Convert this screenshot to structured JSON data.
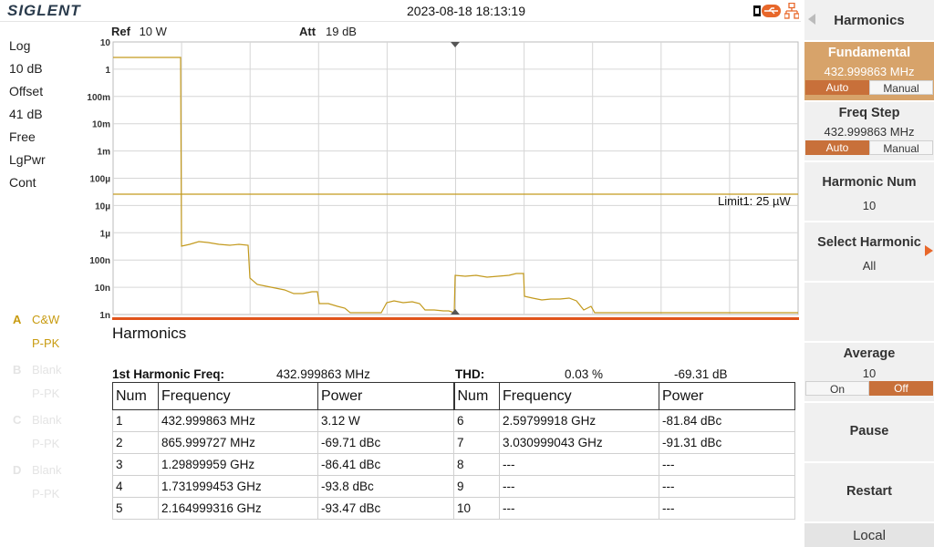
{
  "top_bar": {
    "brand": "SIGLENT",
    "datetime": "2023-08-18 18:13:19"
  },
  "left_status": [
    "Log",
    "10 dB",
    "Offset",
    "41 dB",
    "Free",
    "LgPwr",
    "Cont"
  ],
  "traces": [
    {
      "letter": "A",
      "name": "C&W",
      "sub": "P-PK",
      "active": true
    },
    {
      "letter": "B",
      "name": "Blank",
      "sub": "P-PK",
      "active": false
    },
    {
      "letter": "C",
      "name": "Blank",
      "sub": "P-PK",
      "active": false
    },
    {
      "letter": "D",
      "name": "Blank",
      "sub": "P-PK",
      "active": false
    }
  ],
  "plot_header": {
    "ref_label": "Ref",
    "ref_value": "10 W",
    "att_label": "Att",
    "att_value": "19 dB"
  },
  "y_ticks": [
    "10",
    "1",
    "100m",
    "10m",
    "1m",
    "100µ",
    "10µ",
    "1µ",
    "100n",
    "10n",
    "1n"
  ],
  "limit_label": "Limit1: 25 µW",
  "harmonics": {
    "title": "Harmonics",
    "freq_label": "1st Harmonic Freq:",
    "freq_value": "432.999863 MHz",
    "thd_label": "THD:",
    "thd_percent": "0.03 %",
    "thd_db": "-69.31 dB",
    "columns": [
      "Num",
      "Frequency",
      "Power",
      "Num",
      "Frequency",
      "Power"
    ],
    "rows": [
      [
        "1",
        "432.999863 MHz",
        "3.12 W",
        "6",
        "2.59799918 GHz",
        "-81.84 dBc"
      ],
      [
        "2",
        "865.999727 MHz",
        "-69.71 dBc",
        "7",
        "3.030999043 GHz",
        "-91.31 dBc"
      ],
      [
        "3",
        "1.29899959 GHz",
        "-86.41 dBc",
        "8",
        "---",
        "---"
      ],
      [
        "4",
        "1.731999453 GHz",
        "-93.8 dBc",
        "9",
        "---",
        "---"
      ],
      [
        "5",
        "2.164999316 GHz",
        "-93.47 dBc",
        "10",
        "---",
        "---"
      ]
    ]
  },
  "menu": {
    "header": "Harmonics",
    "fundamental": {
      "title": "Fundamental",
      "value": "432.999863 MHz",
      "auto": "Auto",
      "manual": "Manual"
    },
    "freq_step": {
      "title": "Freq Step",
      "value": "432.999863 MHz",
      "auto": "Auto",
      "manual": "Manual"
    },
    "harmonic_num": {
      "title": "Harmonic Num",
      "value": "10"
    },
    "select_harmonic": {
      "title": "Select Harmonic",
      "value": "All"
    },
    "average": {
      "title": "Average",
      "value": "10",
      "on": "On",
      "off": "Off"
    },
    "pause": "Pause",
    "restart": "Restart",
    "local": "Local"
  },
  "colors": {
    "trace": "#c39a1e",
    "limit": "#c39a1e",
    "accent": "#e0541c",
    "selected_key": "#c8703a"
  },
  "icons": [
    "usb-icon",
    "lan-icon",
    "menu-back-arrow-icon",
    "submenu-arrow-icon"
  ]
}
